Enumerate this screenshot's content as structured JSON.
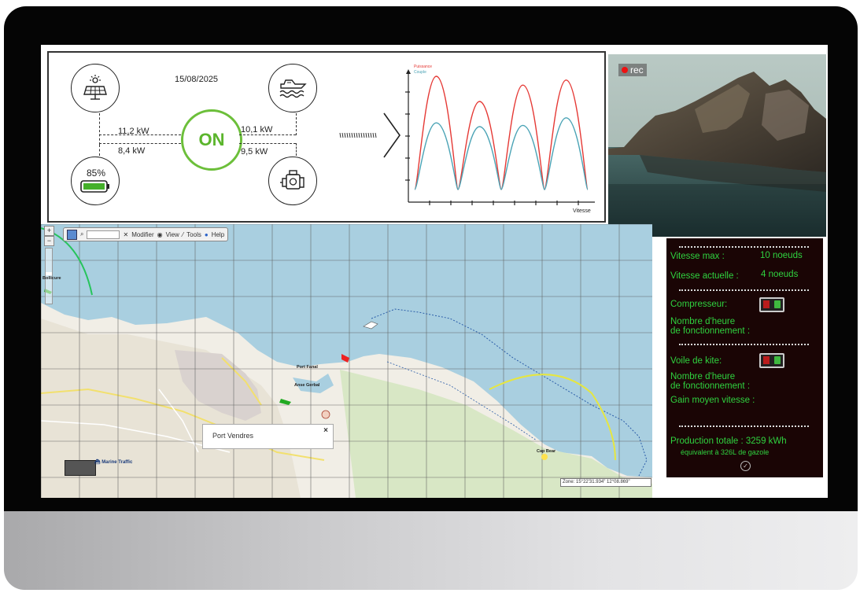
{
  "energy": {
    "date": "15/08/2025",
    "status": "ON",
    "solar_kw": "11,2 kW",
    "battery_kw": "8,4 kW",
    "battery_level": "85%",
    "propulsion_kw": "10,1 kW",
    "engine_kw": "9,5 kW"
  },
  "power_chart": {
    "legend_power": "Puissance",
    "legend_torque": "Couple",
    "xlabel": "Vitesse"
  },
  "chart_data": {
    "type": "line",
    "title": "",
    "xlabel": "Vitesse",
    "ylabel": "",
    "series": [
      {
        "name": "Puissance",
        "color": "#e53935",
        "values": [
          0.05,
          0.95,
          0.05,
          0.75,
          0.05,
          0.88,
          0.05,
          0.92,
          0.05
        ]
      },
      {
        "name": "Couple",
        "color": "#4aa3b5",
        "values": [
          0.05,
          0.58,
          0.05,
          0.55,
          0.05,
          0.56,
          0.05,
          0.62,
          0.05
        ]
      }
    ]
  },
  "camera": {
    "rec_label": "rec"
  },
  "map": {
    "toolbar": {
      "modify": "Modifier",
      "view": "View",
      "tools": "Tools",
      "help": "Help"
    },
    "popup_title": "Port Vendres",
    "popup_close": "×",
    "labels": {
      "port_fanal": "Port Fanal",
      "anse": "Anse Gerbal",
      "cap_bear": "Cap Bear",
      "marine_traffic": "Marine Traffic",
      "bollicuro": "Bollicure"
    },
    "coordinates": "Zone: 15°22'31.934\" 12°08.869\""
  },
  "info": {
    "vitesse_max_label": "Vitesse max :",
    "vitesse_max_value": "10 noeuds",
    "vitesse_actuelle_label": "Vitesse actuelle :",
    "vitesse_actuelle_value": "4 noeuds",
    "compresseur_label": "Compresseur:",
    "heures1_line1": "Nombre d'heure",
    "heures1_line2": "de fonctionnement :",
    "voile_label": "Voile  de kite:",
    "heures2_line1": "Nombre d'heure",
    "heures2_line2": "de fonctionnement :",
    "gain_label": "Gain moyen vitesse :",
    "production_label": "Production totale : 3259 kWh",
    "equivalent_label": "équivalent à 326L de gazole"
  },
  "colors": {
    "status_green": "#5bb52c",
    "info_text": "#2fd23f",
    "info_bg": "#1a0505",
    "rec_red": "#e11111"
  }
}
